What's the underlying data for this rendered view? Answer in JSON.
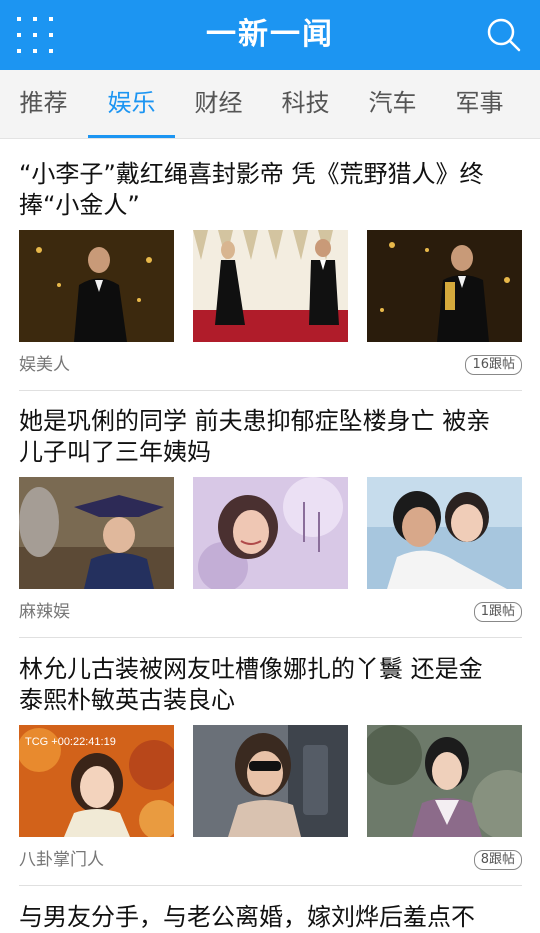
{
  "header": {
    "title": "一新一闻",
    "menu_icon": "grid-icon",
    "search_icon": "search-icon",
    "bar_color": "#1c95f2"
  },
  "tabs": [
    {
      "label": "推荐",
      "active": false
    },
    {
      "label": "娱乐",
      "active": true
    },
    {
      "label": "财经",
      "active": false
    },
    {
      "label": "科技",
      "active": false
    },
    {
      "label": "汽车",
      "active": false
    },
    {
      "label": "军事",
      "active": false
    }
  ],
  "articles": [
    {
      "title_line1": "“小李子”戴红绳喜封影帝 凭《荒野猎人》终",
      "title_line2": "捧“小金人”",
      "source": "娱美人",
      "comments": "16跟帖"
    },
    {
      "title_line1": "她是巩俐的同学 前夫患抑郁症坠楼身亡 被亲",
      "title_line2": "儿子叫了三年姨妈",
      "source": "麻辣娱",
      "comments": "1跟帖"
    },
    {
      "title_line1": "林允儿古装被网友吐槽像娜扎的丫鬟 还是金",
      "title_line2": "泰熙朴敏英古装良心",
      "source": "八卦掌门人",
      "comments": "8跟帖",
      "thumb_caption": "TCG +00:22:41:19"
    },
    {
      "title_line1": "与男友分手，与老公离婚，嫁刘烨后羞点不"
    }
  ]
}
